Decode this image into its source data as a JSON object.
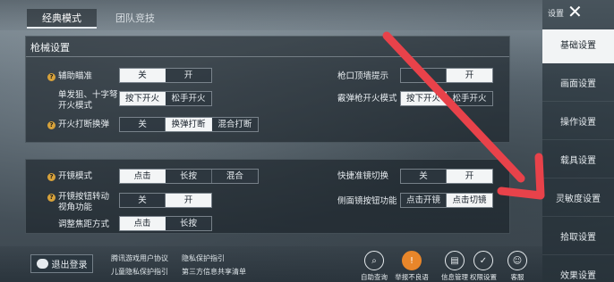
{
  "tabs": [
    {
      "label": "经典模式"
    },
    {
      "label": "团队竞技"
    }
  ],
  "weapon_section": {
    "title": "枪械设置"
  },
  "settings": {
    "aim_assist": {
      "label": "辅助瞄准",
      "options": [
        "关",
        "开"
      ],
      "selected": 0
    },
    "muzzle_hint": {
      "label": "枪口顶墙提示",
      "options": [
        "",
        "开"
      ],
      "selected": 1
    },
    "single_fire": {
      "label": "单发狙、十字弩开火模式",
      "options": [
        "按下开火",
        "松手开火"
      ],
      "selected": 0
    },
    "shotgun_fire": {
      "label": "霰弹枪开火模式",
      "options": [
        "按下开火",
        "松手开火"
      ],
      "selected": 0
    },
    "fire_switch": {
      "label": "开火打断换弹",
      "options": [
        "关",
        "换弹打断",
        "混合打断"
      ],
      "selected": 1
    },
    "scope_mode": {
      "label": "开镜模式",
      "options": [
        "点击",
        "长按",
        "混合"
      ],
      "selected": 0
    },
    "quick_scope": {
      "label": "快捷准镜切换",
      "options": [
        "关",
        "开"
      ],
      "selected": 1
    },
    "scope_button_view": {
      "label": "开镜按钮转动视角功能",
      "options": [
        "关",
        "开"
      ],
      "selected": 1
    },
    "side_scope": {
      "label": "侧面镜按钮功能",
      "options": [
        "点击开镜",
        "点击切镜"
      ],
      "selected": 1
    },
    "focus_mode": {
      "label": "调整焦距方式",
      "options": [
        "点击",
        "长按"
      ],
      "selected": 0
    }
  },
  "sidebar": {
    "title": "设置",
    "items": [
      {
        "label": "基础设置"
      },
      {
        "label": "画面设置"
      },
      {
        "label": "操作设置"
      },
      {
        "label": "载具设置"
      },
      {
        "label": "灵敏度设置"
      },
      {
        "label": "拾取设置"
      },
      {
        "label": "效果设置"
      }
    ],
    "selected": 0
  },
  "footer": {
    "logout": "退出登录",
    "links": [
      "腾讯游戏用户协议",
      "隐私保护指引",
      "儿童隐私保护指引",
      "第三方信息共享清单"
    ],
    "icons": [
      {
        "icon": "lens-icon",
        "label": "自助查询"
      },
      {
        "icon": "warning-icon",
        "label": "举报不良语音"
      },
      {
        "icon": "info-icon",
        "label": "信息管理"
      },
      {
        "icon": "shield-icon",
        "label": "权限设置"
      },
      {
        "icon": "headset-icon",
        "label": "客服"
      }
    ]
  },
  "annotation": {
    "color": "#e8424a"
  }
}
